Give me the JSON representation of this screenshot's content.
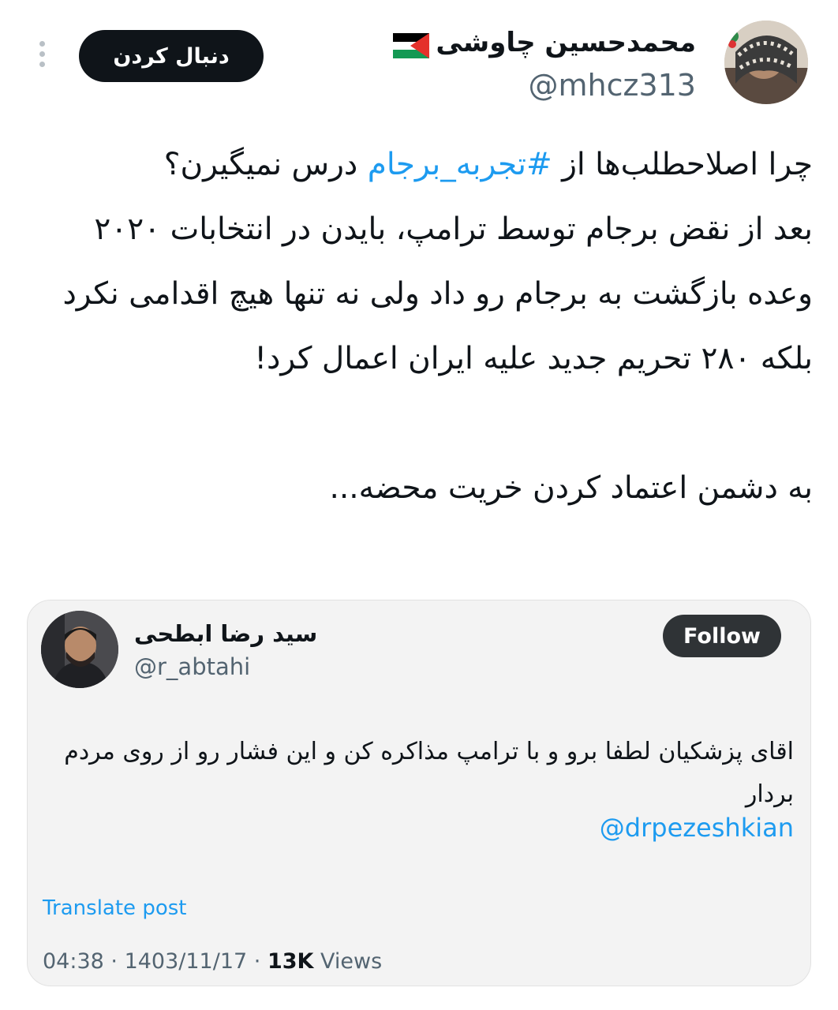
{
  "tweet": {
    "author_name": "محمدحسین چاوشی",
    "author_handle": "@mhcz313",
    "follow_label": "دنبال کردن",
    "flag_icon": "palestine-flag-icon",
    "more_icon": "more-options-icon",
    "text_before_hashtag": "چرا اصلاحطلب‌ها از ",
    "hashtag": "#تجربه_برجام",
    "text_after_hashtag": " درس نمیگیرن؟\nبعد از نقض برجام توسط ترامپ، بایدن در انتخابات ۲۰۲۰ وعده بازگشت به برجام رو داد ولی نه تنها هیچ اقدامی نکرد بلکه ۲۸۰ تحریم جدید علیه ایران اعمال کرد!\n\nبه دشمن اعتماد کردن خریت محضه..."
  },
  "quote": {
    "author_name": "سید رضا ابطحی",
    "author_handle": "@r_abtahi",
    "follow_label": "Follow",
    "text": "اقای پزشکیان لطفا برو و با ترامپ مذاکره کن و این فشار رو از روی مردم بردار",
    "mention": "@drpezeshkian",
    "translate_label": "Translate post",
    "time": "04:38",
    "separator": " · ",
    "date": "1403/11/17",
    "views_count": "13K",
    "views_label": " Views"
  },
  "colors": {
    "link": "#1d9bf0",
    "follow_button": "#0f1419",
    "quote_bg": "#f3f3f3"
  }
}
